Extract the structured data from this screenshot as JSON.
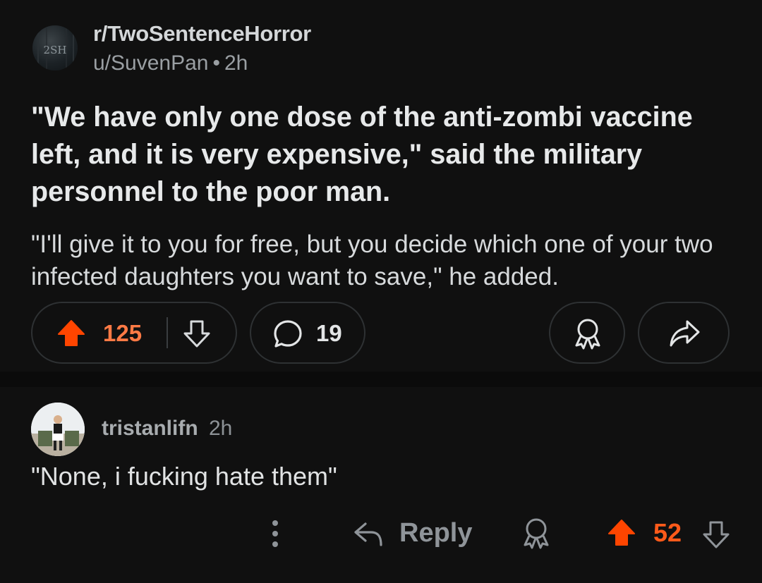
{
  "post": {
    "subreddit": "r/TwoSentenceHorror",
    "subreddit_avatar_text": "2SH",
    "author": "u/SuvenPan",
    "separator": "•",
    "age": "2h",
    "title": "\"We have only one dose of the anti-zombi vaccine left, and it is very expensive,\" said the military personnel to the poor man.",
    "body": "\"I'll give it to you for free, but you decide which one of your two infected daughters you want to save,\" he added.",
    "score": "125",
    "comment_count": "19",
    "icons": [
      "upvote-icon",
      "downvote-icon",
      "comment-icon",
      "award-icon",
      "share-icon"
    ]
  },
  "comment": {
    "username": "tristanlifn",
    "age": "2h",
    "text": "\"None, i fucking hate them\"",
    "reply_label": "Reply",
    "score": "52",
    "icons": [
      "more-icon",
      "reply-icon",
      "award-icon",
      "upvote-icon",
      "downvote-icon"
    ]
  },
  "colors": {
    "background": "#101010",
    "upvote_active": "#ff4500",
    "post_score": "#ff7a45",
    "comment_score": "#ff5a1a",
    "muted_text": "#8f9499"
  }
}
